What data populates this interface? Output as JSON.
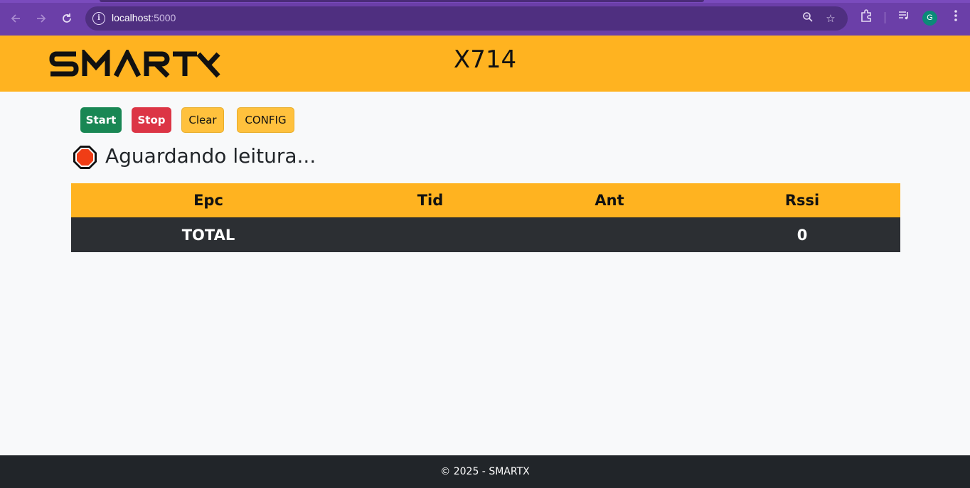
{
  "browser": {
    "url_host": "localhost",
    "url_port": ":5000",
    "profile_initial": "G",
    "icons": [
      "back-icon",
      "forward-icon",
      "reload-icon",
      "info-icon",
      "zoom-icon",
      "star-icon",
      "extensions-icon",
      "media-icon",
      "menu-icon"
    ]
  },
  "header": {
    "logo_text": "SMARTX",
    "device_title": "X714"
  },
  "toolbar": {
    "start_label": "Start",
    "stop_label": "Stop",
    "clear_label": "Clear",
    "config_label": "CONFIG"
  },
  "status": {
    "icon": "stop-sign-icon",
    "text": "Aguardando leitura..."
  },
  "table": {
    "columns": [
      "Epc",
      "Tid",
      "Ant",
      "Rssi"
    ],
    "rows": [],
    "footer": {
      "label": "TOTAL",
      "count": "0"
    }
  },
  "footer": {
    "text": "© 2025 - SMARTX"
  },
  "colors": {
    "header_bg": "#ffb320",
    "start": "#198754",
    "stop": "#dc3545",
    "warning": "#ffc13d",
    "dark": "#212529",
    "browser": "#6b3fa8"
  }
}
